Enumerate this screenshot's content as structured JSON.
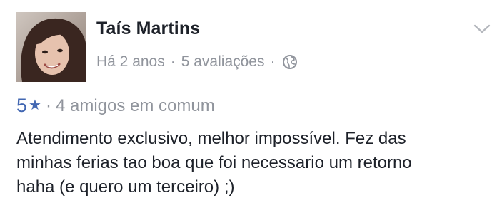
{
  "review": {
    "author": "Taís Martins",
    "time_ago": "Há 2 anos",
    "separator": "·",
    "reviews_count": "5 avaliações",
    "privacy_icon": "globe-icon",
    "menu_icon": "chevron-down-icon",
    "rating_value": "5",
    "rating_icon": "star-icon",
    "rating_star": "★",
    "mutual_friends": "4 amigos em comum",
    "text_lines": [
      "Atendimento exclusivo, melhor impossível. Fez das",
      "minhas ferias tao boa que foi necessario um retorno",
      "haha (e quero um terceiro) ;)"
    ]
  },
  "colors": {
    "name": "#1d2129",
    "meta": "#90949c",
    "rating_accent": "#4267b2",
    "body_text": "#1d2129"
  }
}
